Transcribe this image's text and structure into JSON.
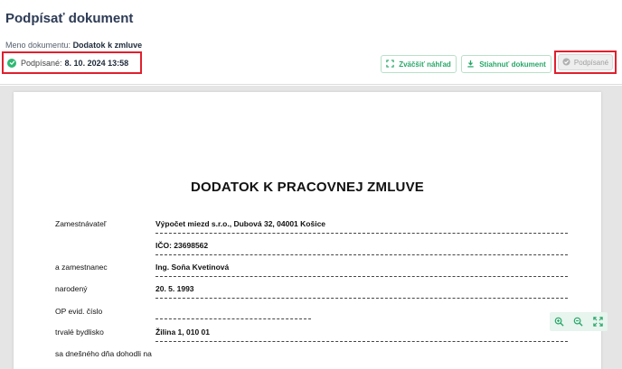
{
  "header": {
    "title": "Podpísať dokument",
    "doc_name_label": "Meno dokumentu:",
    "doc_name_value": "Dodatok k zmluve",
    "signed_label": "Podpísané:",
    "signed_value": "8. 10. 2024 13:58"
  },
  "toolbar": {
    "enlarge_label": "Zväčšiť náhľad",
    "download_label": "Stiahnuť dokument",
    "signed_button_label": "Podpísané"
  },
  "document": {
    "title": "DODATOK K PRACOVNEJ ZMLUVE",
    "rows": [
      {
        "label": "Zamestnávateľ",
        "value": "Výpočet miezd s.r.o., Dubová 32, 04001 Košice"
      },
      {
        "label": "",
        "value": "IČO: 23698562"
      },
      {
        "label": "a zamestnanec",
        "value": "Ing. Soňa Kvetinová"
      },
      {
        "label": "narodený",
        "value": "20. 5. 1993"
      },
      {
        "label": "OP evid. číslo",
        "value": ""
      },
      {
        "label": "trvalé bydlisko",
        "value": "Žilina 1, 010 01"
      },
      {
        "label": "sa dnešného dňa dohodli na",
        "value": ""
      }
    ]
  },
  "icons": {
    "signed_check": "check-circle-icon",
    "enlarge": "expand-icon",
    "download": "download-icon",
    "zoom_in": "zoom-in-icon",
    "zoom_out": "zoom-out-icon",
    "fullscreen": "fullscreen-icon"
  },
  "colors": {
    "accent_green": "#27a768",
    "highlight_red": "#e0202e",
    "title_navy": "#2d3b55"
  }
}
